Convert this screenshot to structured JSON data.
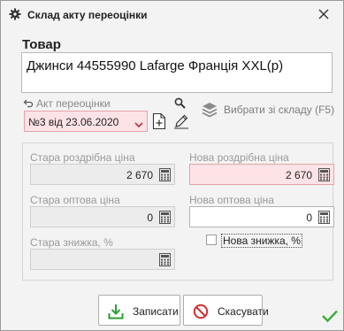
{
  "window": {
    "title": "Склад акту переоцінки",
    "icon": "gear-icon",
    "close_icon": "close-icon"
  },
  "goods": {
    "label": "Товар",
    "value": "Джинси 44555990 Lafarge Франція XXL(р)"
  },
  "act": {
    "label": "Акт переоцінки",
    "selected": "№3 від 23.06.2020",
    "pick_from_stock": "Вибрати зі складу (F5)"
  },
  "fields": {
    "old_retail": {
      "label": "Стара роздрібна ціна",
      "value": "2 670"
    },
    "new_retail": {
      "label": "Нова роздрібна ціна",
      "value": "2 670"
    },
    "old_wholesale": {
      "label": "Стара оптова ціна",
      "value": "0"
    },
    "new_wholesale": {
      "label": "Нова оптова ціна",
      "value": "0"
    },
    "old_discount": {
      "label": "Стара знижка, %",
      "value": ""
    },
    "new_discount": {
      "label": "Нова знижка, %",
      "checked": false
    }
  },
  "buttons": {
    "save": "Записати",
    "cancel": "Скасувати"
  },
  "colors": {
    "required_bg": "#fde3e6",
    "ok_green": "#3cae3c",
    "cancel_red": "#d03030",
    "save_green": "#2e9e36"
  }
}
